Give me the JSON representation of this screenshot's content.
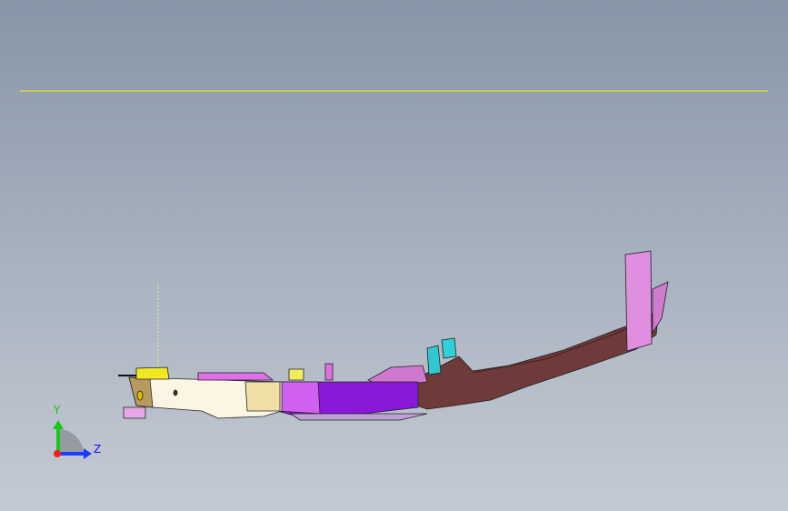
{
  "viewport": {
    "triad": {
      "y_label": "Y",
      "z_label": "Z"
    },
    "colors": {
      "x_axis": "#ff1a1a",
      "y_axis": "#18c818",
      "z_axis": "#1a3cff",
      "plane_line": "#e8e020"
    }
  }
}
